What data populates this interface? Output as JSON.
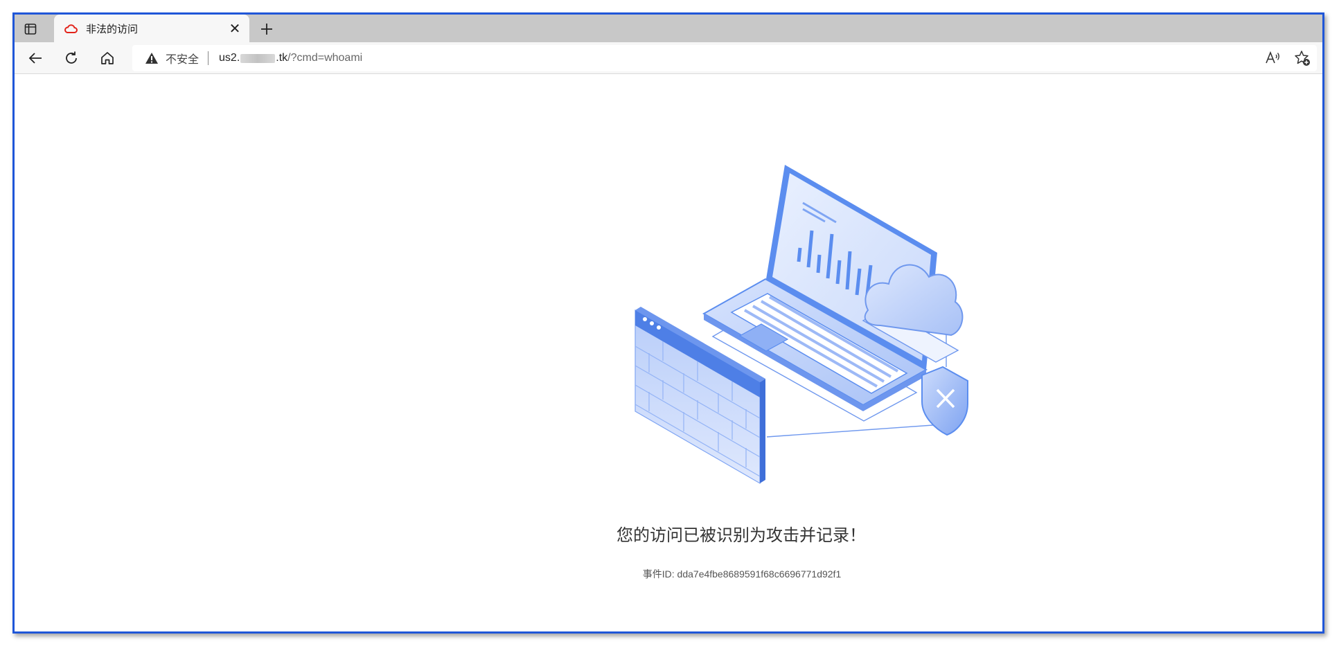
{
  "tab": {
    "title": "非法的访问",
    "close_glyph": "✕",
    "favicon": "cloud-icon"
  },
  "toolbar": {
    "insecure_label": "不安全",
    "url_host_prefix": "us2.",
    "url_host_suffix": ".tk",
    "url_path": "/?cmd=whoami"
  },
  "page": {
    "message": "您的访问已被识别为攻击并记录！",
    "event_id": "事件ID: dda7e4fbe8689591f68c6696771d92f1"
  },
  "colors": {
    "window_border": "#1f56d8",
    "favicon_red": "#e2231a",
    "illustration_blue": "#5b8def"
  }
}
